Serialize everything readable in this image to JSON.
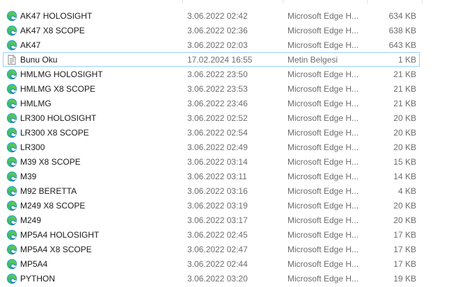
{
  "files": [
    {
      "name": "AK47 HOLOSIGHT",
      "date": "3.06.2022 02:42",
      "type": "Microsoft Edge H...",
      "size": "634 KB",
      "icon": "edge-icon"
    },
    {
      "name": "AK47 X8 SCOPE",
      "date": "3.06.2022 02:36",
      "type": "Microsoft Edge H...",
      "size": "638 KB",
      "icon": "edge-icon"
    },
    {
      "name": "AK47",
      "date": "3.06.2022 02:03",
      "type": "Microsoft Edge H...",
      "size": "643 KB",
      "icon": "edge-icon"
    },
    {
      "name": "Bunu Oku",
      "date": "17.02.2024 16:55",
      "type": "Metin Belgesi",
      "size": "1 KB",
      "icon": "text-document-icon",
      "selected": true
    },
    {
      "name": "HMLMG HOLOSIGHT",
      "date": "3.06.2022 23:50",
      "type": "Microsoft Edge H...",
      "size": "21 KB",
      "icon": "edge-icon"
    },
    {
      "name": "HMLMG X8 SCOPE",
      "date": "3.06.2022 23:53",
      "type": "Microsoft Edge H...",
      "size": "21 KB",
      "icon": "edge-icon"
    },
    {
      "name": "HMLMG",
      "date": "3.06.2022 23:46",
      "type": "Microsoft Edge H...",
      "size": "21 KB",
      "icon": "edge-icon"
    },
    {
      "name": "LR300 HOLOSIGHT",
      "date": "3.06.2022 02:52",
      "type": "Microsoft Edge H...",
      "size": "20 KB",
      "icon": "edge-icon"
    },
    {
      "name": "LR300 X8 SCOPE",
      "date": "3.06.2022 02:54",
      "type": "Microsoft Edge H...",
      "size": "20 KB",
      "icon": "edge-icon"
    },
    {
      "name": "LR300",
      "date": "3.06.2022 02:49",
      "type": "Microsoft Edge H...",
      "size": "20 KB",
      "icon": "edge-icon"
    },
    {
      "name": "M39 X8 SCOPE",
      "date": "3.06.2022 03:14",
      "type": "Microsoft Edge H...",
      "size": "15 KB",
      "icon": "edge-icon"
    },
    {
      "name": "M39",
      "date": "3.06.2022 03:11",
      "type": "Microsoft Edge H...",
      "size": "14 KB",
      "icon": "edge-icon"
    },
    {
      "name": "M92 BERETTA",
      "date": "3.06.2022 03:16",
      "type": "Microsoft Edge H...",
      "size": "4 KB",
      "icon": "edge-icon"
    },
    {
      "name": "M249 X8 SCOPE",
      "date": "3.06.2022 03:19",
      "type": "Microsoft Edge H...",
      "size": "20 KB",
      "icon": "edge-icon"
    },
    {
      "name": "M249",
      "date": "3.06.2022 03:17",
      "type": "Microsoft Edge H...",
      "size": "20 KB",
      "icon": "edge-icon"
    },
    {
      "name": "MP5A4 HOLOSIGHT",
      "date": "3.06.2022 02:45",
      "type": "Microsoft Edge H...",
      "size": "17 KB",
      "icon": "edge-icon"
    },
    {
      "name": "MP5A4 X8 SCOPE",
      "date": "3.06.2022 02:47",
      "type": "Microsoft Edge H...",
      "size": "17 KB",
      "icon": "edge-icon"
    },
    {
      "name": "MP5A4",
      "date": "3.06.2022 02:44",
      "type": "Microsoft Edge H...",
      "size": "17 KB",
      "icon": "edge-icon"
    },
    {
      "name": "PYTHON",
      "date": "3.06.2022 03:20",
      "type": "Microsoft Edge H...",
      "size": "19 KB",
      "icon": "edge-icon"
    }
  ],
  "colors": {
    "text_primary": "#1a1a1a",
    "text_secondary": "#6d6d6d",
    "selection_border": "#99d1ff",
    "edge_blue": "#0c59a4",
    "edge_green": "#4fc234"
  }
}
